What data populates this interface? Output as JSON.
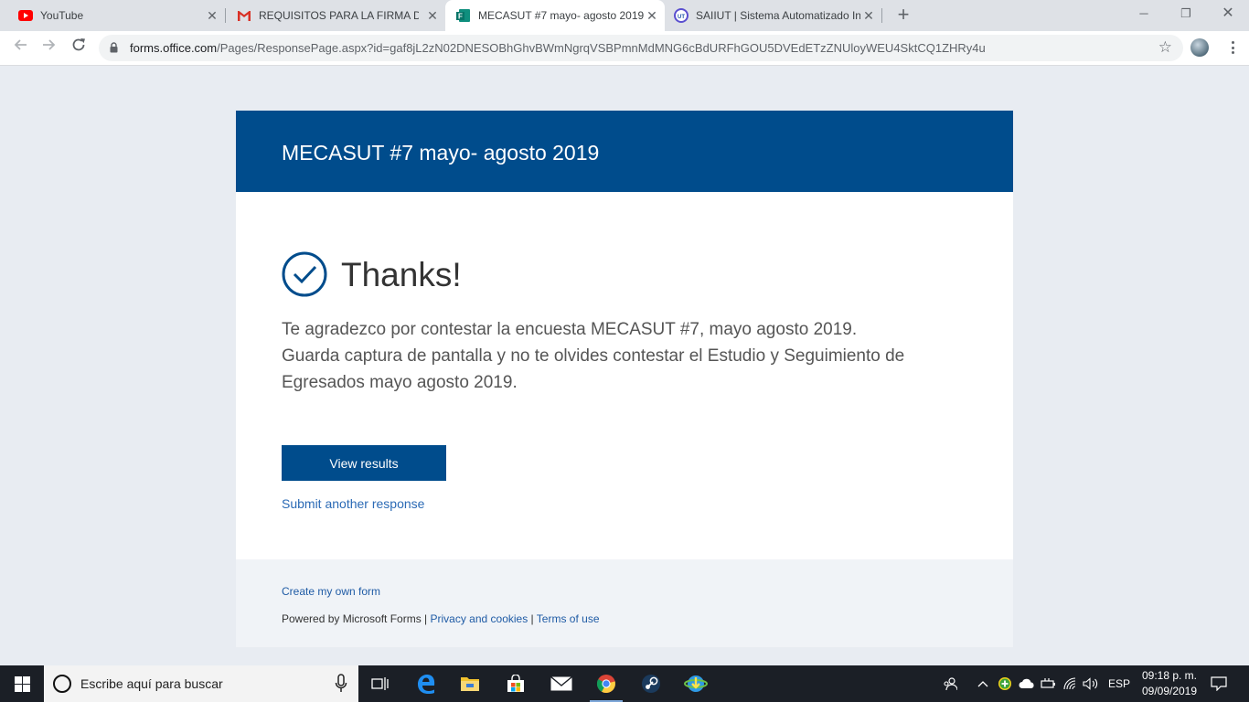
{
  "browser": {
    "tabs": [
      {
        "title": "YouTube",
        "icon": "youtube-icon"
      },
      {
        "title": "REQUISITOS PARA LA FIRMA DEL",
        "icon": "gmail-icon"
      },
      {
        "title": "MECASUT #7 mayo- agosto 2019",
        "icon": "forms-icon",
        "active": true
      },
      {
        "title": "SAIIUT | Sistema Automatizado In",
        "icon": "saiiut-icon"
      }
    ],
    "url_host": "forms.office.com",
    "url_path": "/Pages/ResponsePage.aspx?id=gaf8jL2zN02DNESOBhGhvBWmNgrqVSBPmnMdMNG6cBdURFhGOU5DVEdETzZNUloyWEU4SktCQ1ZHRy4u"
  },
  "form": {
    "title": "MECASUT #7 mayo- agosto 2019",
    "thanks": "Thanks!",
    "message_lines": [
      "Te agradezco por contestar la encuesta MECASUT #7, mayo agosto 2019.",
      "Guarda captura de pantalla y no te olvides contestar el Estudio y Seguimiento de",
      "Egresados mayo agosto 2019."
    ],
    "view_results": "View results",
    "submit_another": "Submit another response"
  },
  "footer": {
    "create": "Create my own form",
    "powered": "Powered by Microsoft Forms | ",
    "privacy": "Privacy and cookies",
    "sep": " | ",
    "terms": "Terms of use"
  },
  "taskbar": {
    "search_placeholder": "Escribe aquí para buscar",
    "language": "ESP",
    "time": "09:18 p. m.",
    "date": "09/09/2019"
  },
  "colors": {
    "header_blue": "#004c8c",
    "link_blue": "#2b6ab5",
    "page_bg": "#e8ecf2"
  }
}
